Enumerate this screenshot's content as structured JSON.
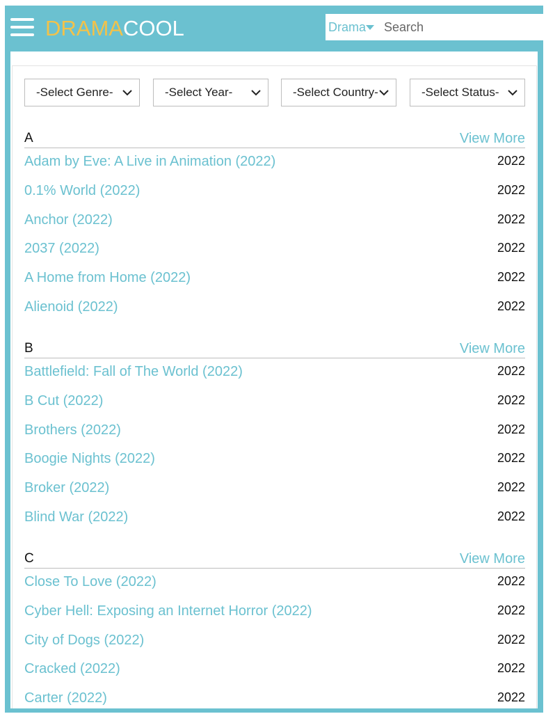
{
  "header": {
    "logo_part1": "DRAMA",
    "logo_part2": "COOL",
    "search_type": "Drama",
    "search_placeholder": "Search",
    "icons": {
      "menu": "hamburger-icon",
      "search": "search-icon",
      "dropdown": "triangle-down-icon"
    }
  },
  "filters": [
    {
      "label": "-Select Genre-"
    },
    {
      "label": "-Select Year-"
    },
    {
      "label": "-Select Country-"
    },
    {
      "label": "-Select Status-"
    }
  ],
  "sections": [
    {
      "letter": "A",
      "view_more": "View More",
      "items": [
        {
          "title": "Adam by Eve: A Live in Animation (2022)",
          "year": "2022"
        },
        {
          "title": "0.1% World (2022)",
          "year": "2022"
        },
        {
          "title": "Anchor (2022)",
          "year": "2022"
        },
        {
          "title": "2037 (2022)",
          "year": "2022"
        },
        {
          "title": "A Home from Home (2022)",
          "year": "2022"
        },
        {
          "title": "Alienoid (2022)",
          "year": "2022"
        }
      ]
    },
    {
      "letter": "B",
      "view_more": "View More",
      "items": [
        {
          "title": "Battlefield: Fall of The World (2022)",
          "year": "2022"
        },
        {
          "title": "B Cut (2022)",
          "year": "2022"
        },
        {
          "title": "Brothers (2022)",
          "year": "2022"
        },
        {
          "title": "Boogie Nights (2022)",
          "year": "2022"
        },
        {
          "title": "Broker (2022)",
          "year": "2022"
        },
        {
          "title": "Blind War (2022)",
          "year": "2022"
        }
      ]
    },
    {
      "letter": "C",
      "view_more": "View More",
      "items": [
        {
          "title": "Close To Love (2022)",
          "year": "2022"
        },
        {
          "title": "Cyber Hell: Exposing an Internet Horror (2022)",
          "year": "2022"
        },
        {
          "title": "City of Dogs (2022)",
          "year": "2022"
        },
        {
          "title": "Cracked (2022)",
          "year": "2022"
        },
        {
          "title": "Carter (2022)",
          "year": "2022"
        }
      ]
    }
  ],
  "colors": {
    "accent": "#6bc1d0",
    "logo_gold": "#f2c24a",
    "search_button": "#f2b83a"
  }
}
